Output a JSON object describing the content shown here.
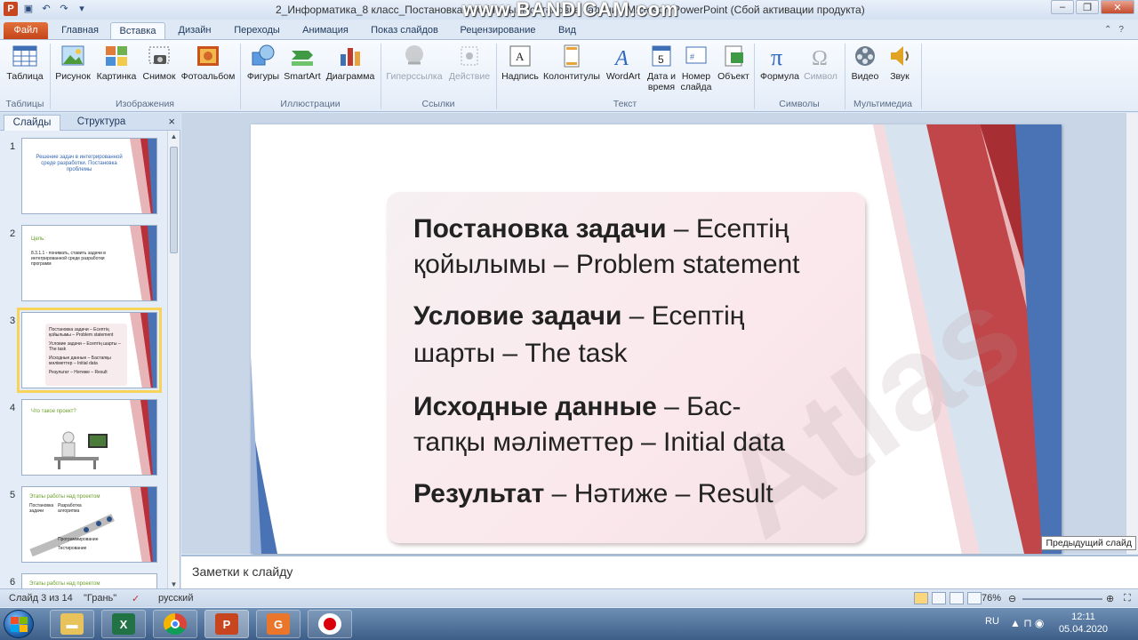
{
  "titlebar": {
    "title": "2_Информатика_8 класс_Постановка проблемы. Постановка задачи - Microsoft PowerPoint (Сбой активации продукта)",
    "watermark": "www.BANDICAM.com"
  },
  "tabs": [
    "Файл",
    "Главная",
    "Вставка",
    "Дизайн",
    "Переходы",
    "Анимация",
    "Показ слайдов",
    "Рецензирование",
    "Вид"
  ],
  "active_tab": "Вставка",
  "ribbon": {
    "groups": [
      "Таблицы",
      "Изображения",
      "Иллюстрации",
      "Ссылки",
      "Текст",
      "Символы",
      "Мультимедиа"
    ],
    "buttons": {
      "table": "Таблица",
      "picture": "Рисунок",
      "clipart": "Картинка",
      "screenshot": "Снимок",
      "photoalbum": "Фотоальбом",
      "shapes": "Фигуры",
      "smartart": "SmartArt",
      "chart": "Диаграмма",
      "hyperlink": "Гиперссылка",
      "action": "Действие",
      "textbox": "Надпись",
      "headerfooter": "Колонтитулы",
      "wordart": "WordArt",
      "datetime_1": "Дата и",
      "datetime_2": "время",
      "slidenum_1": "Номер",
      "slidenum_2": "слайда",
      "object": "Объект",
      "equation": "Формула",
      "symbol": "Символ",
      "video": "Видео",
      "audio": "Звук"
    }
  },
  "leftpane": {
    "tab_slides": "Слайды",
    "tab_outline": "Структура",
    "close": "×",
    "thumbs": [
      {
        "num": "1",
        "text": "Решение задач в интегрированной среде разработки. Постановка проблемы"
      },
      {
        "num": "2",
        "title": "Цель:",
        "text": "8.3.1.1 - понимать, ставить задачи в интегрированной среде разработки программ"
      },
      {
        "num": "3",
        "lines": [
          "Постановка задачи – Есептің қойылымы – Problem statement",
          "Условие задачи – Есептің шарты – The task",
          "Исходные данные – Бастапқы мәліметтер – Initial data",
          "Результат – Нәтиже – Result"
        ]
      },
      {
        "num": "4",
        "title": "Что такое проект?"
      },
      {
        "num": "5",
        "title": "Этапы работы над проектом",
        "cols": [
          "Постановка задачи",
          "Разработка алгоритма",
          "Программирование",
          "Тестирование"
        ]
      },
      {
        "num": "6",
        "title": "Этапы работы над проектом"
      }
    ]
  },
  "slide": {
    "lines": [
      {
        "bold": "Постановка  задачи",
        "rest": " – Есептің"
      },
      {
        "bold": "",
        "rest": "қойылымы – Problem statement"
      },
      {
        "bold": "Условие задачи",
        "rest": " – Есептің"
      },
      {
        "bold": "",
        "rest": "шарты – The task"
      },
      {
        "bold": "Исходные данные",
        "rest": " – Бас-"
      },
      {
        "bold": "",
        "rest": "тапқы мәліметтер – Initial data"
      },
      {
        "bold": "Результат",
        "rest": " – Нәтиже – Result"
      }
    ],
    "watermark": "Atlas",
    "tooltip": "Предыдущий слайд"
  },
  "notes": {
    "placeholder": "Заметки к слайду"
  },
  "statusbar": {
    "slide_info": "Слайд 3 из 14",
    "theme": "\"Грань\"",
    "language": "русский",
    "zoom": "76%"
  },
  "taskbar": {
    "lang": "RU",
    "time": "12:11",
    "date": "05.04.2020"
  },
  "colors": {
    "accent_red": "#b8313a",
    "accent_blue": "#4a73b5",
    "file_tab": "#d2582a"
  }
}
